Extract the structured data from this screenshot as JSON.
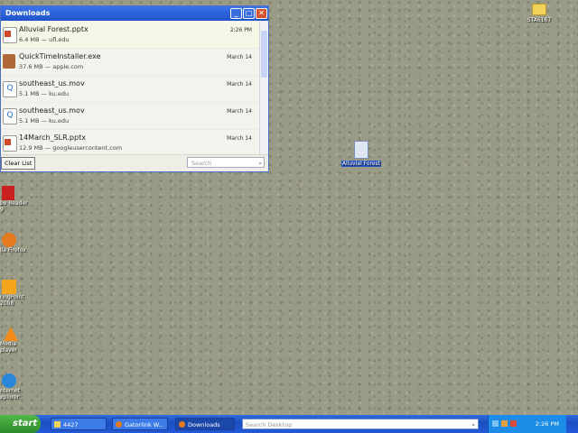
{
  "window": {
    "title": "Downloads"
  },
  "downloads": [
    {
      "name": "Alluvial Forest.pptx",
      "meta": "6.4 MB — ufl.edu",
      "date": "2:26 PM",
      "icon": "pptx-icon"
    },
    {
      "name": "QuickTimeInstaller.exe",
      "meta": "37.6 MB — apple.com",
      "date": "March 14",
      "icon": "installer-icon"
    },
    {
      "name": "southeast_us.mov",
      "meta": "5.1 MB — ku.edu",
      "date": "March 14",
      "icon": "quicktime-icon"
    },
    {
      "name": "southeast_us.mov",
      "meta": "5.1 MB — ku.edu",
      "date": "March 14",
      "icon": "quicktime-icon"
    },
    {
      "name": "14March_SLR.pptx",
      "meta": "12.9 MB — googleusercontent.com",
      "date": "March 14",
      "icon": "pptx-icon"
    }
  ],
  "footer": {
    "clear_label": "Clear List",
    "search_placeholder": "Search"
  },
  "desktop": {
    "top_right_icon": "STA6167",
    "file_icon": "Alluvial Forest",
    "left_icons": [
      "be Reader\n9",
      "lla Firefox",
      "ringPoint\n2008",
      "Media\nplayer",
      "nternet\nxplorer"
    ]
  },
  "taskbar": {
    "start": "start",
    "buttons": [
      "4427",
      "Gatorlink W...",
      "Downloads"
    ],
    "search_placeholder": "Search Desktop",
    "clock": "2:26 PM"
  },
  "colors": {
    "accent": "#1f52c9",
    "taskbar": "#2259d8",
    "start": "#3aa03a"
  }
}
